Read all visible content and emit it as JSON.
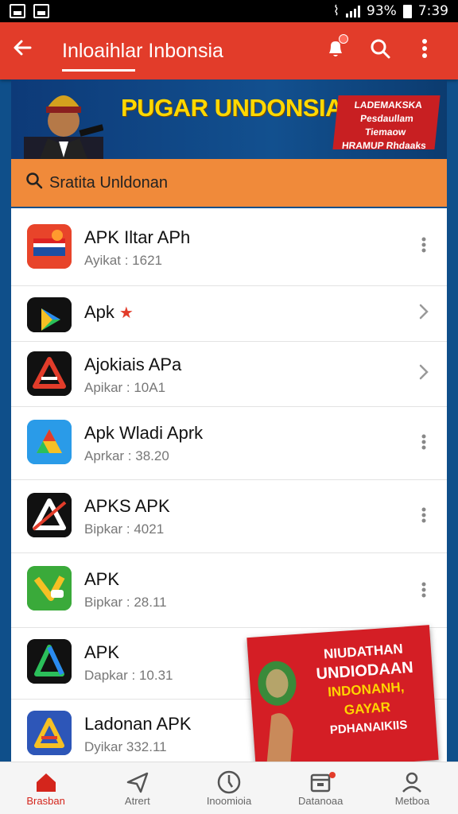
{
  "status_bar": {
    "battery": "93%",
    "time": "7:39"
  },
  "app_bar": {
    "title": "Inloaihlar Inbonsia",
    "back_icon": "back-arrow-icon",
    "notification_icon": "bell-icon",
    "search_icon": "search-icon",
    "menu_icon": "more-vert-icon"
  },
  "banner": {
    "headline": "PUGAR UNDONSIAN",
    "badge_lines": [
      "LADEMAKSKA",
      "Pesdaullam Tiemaow",
      "HRAMUP Rhdaaks"
    ]
  },
  "search": {
    "text": "Sratita Unldonan"
  },
  "apps": [
    {
      "name": "APK Iltar APh",
      "subtitle": "Ayikat : 1621",
      "action": "more"
    },
    {
      "name": "Apk",
      "subtitle": "",
      "action": "chevron"
    },
    {
      "name": "Ajokiais APa",
      "subtitle": "Apikar : 10A1",
      "action": "chevron"
    },
    {
      "name": "Apk Wladi Aprk",
      "subtitle": "Aprkar : 38.20",
      "action": "more"
    },
    {
      "name": "APKS APK",
      "subtitle": "Bipkar : 4021",
      "action": "more"
    },
    {
      "name": "APK",
      "subtitle": "Bipkar : 28.11",
      "action": "more"
    },
    {
      "name": "APK",
      "subtitle": "Dapkar : 10.31",
      "action": "chevron"
    },
    {
      "name": "Ladonan APK",
      "subtitle": "Dyikar 332.11",
      "action": ""
    }
  ],
  "promo": {
    "lines": [
      "NIUDATHAN",
      "UNDIODAAN",
      "INDONANH,",
      "GAYAR",
      "PDHANAIKIIS"
    ]
  },
  "bottom_nav": [
    {
      "label": "Brasban",
      "icon": "home-icon",
      "active": true
    },
    {
      "label": "Atrert",
      "icon": "send-icon",
      "active": false
    },
    {
      "label": "Inoomioia",
      "icon": "compass-icon",
      "active": false
    },
    {
      "label": "Datanoaa",
      "icon": "calendar-icon",
      "active": false
    },
    {
      "label": "Metboa",
      "icon": "profile-icon",
      "active": false
    }
  ],
  "colors": {
    "app_bar": "#e23c2a",
    "search_bar": "#f08a3a",
    "banner_bg": "#0d3a78",
    "accent_active": "#d4251c"
  }
}
